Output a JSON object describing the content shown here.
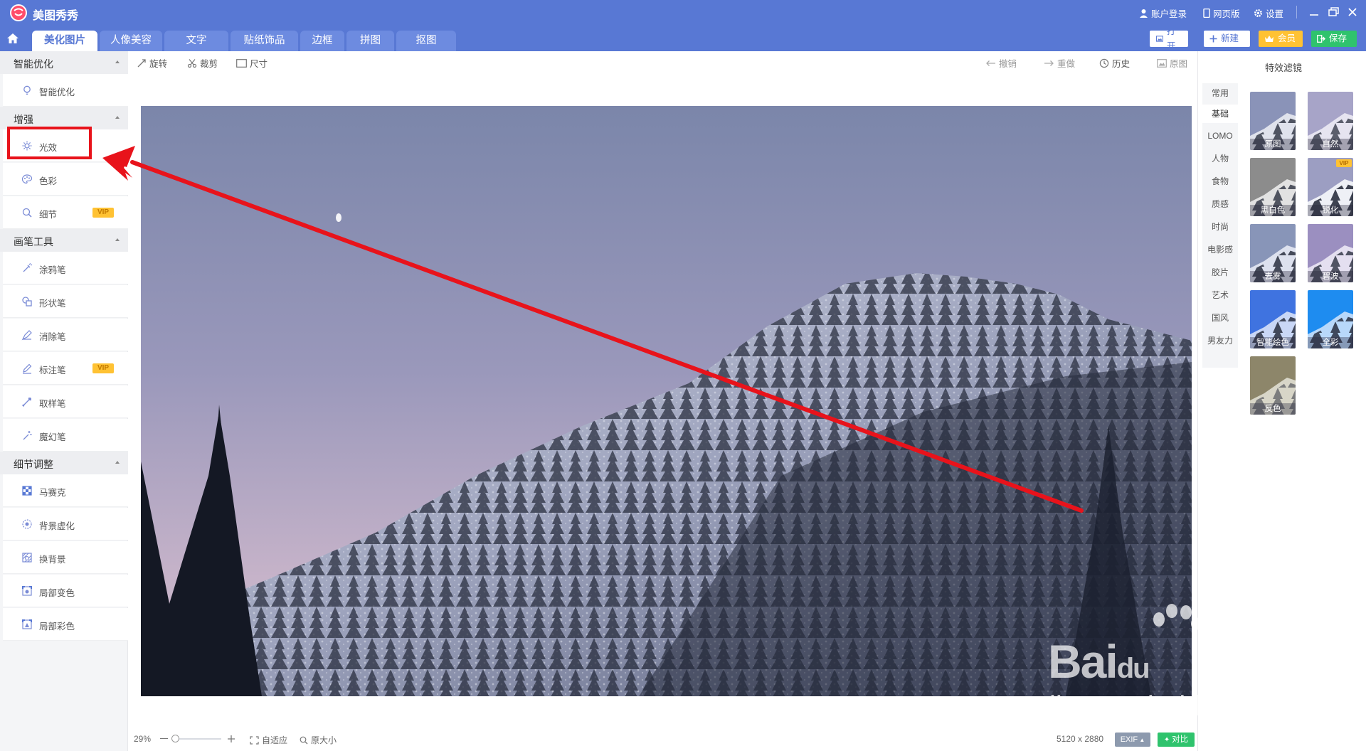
{
  "app": {
    "title": "美图秀秀"
  },
  "titlebar": {
    "login": "账户登录",
    "web": "网页版",
    "settings": "设置"
  },
  "nav": {
    "tabs": [
      "美化图片",
      "人像美容",
      "文字",
      "贴纸饰品",
      "边框",
      "拼图",
      "抠图"
    ],
    "active_index": 0
  },
  "actions": {
    "open": "打开",
    "new": "新建",
    "vip": "会员",
    "save": "保存"
  },
  "left_panel": {
    "sections": [
      {
        "title": "智能优化",
        "items": [
          {
            "label": "智能优化",
            "icon": "bulb-icon"
          }
        ]
      },
      {
        "title": "增强",
        "items": [
          {
            "label": "光效",
            "icon": "sun-icon"
          },
          {
            "label": "色彩",
            "icon": "palette-icon"
          },
          {
            "label": "细节",
            "icon": "magnifier-icon",
            "badge": "VIP"
          }
        ]
      },
      {
        "title": "画笔工具",
        "items": [
          {
            "label": "涂鸦笔",
            "icon": "graffiti-icon"
          },
          {
            "label": "形状笔",
            "icon": "shape-icon"
          },
          {
            "label": "消除笔",
            "icon": "eraser-icon"
          },
          {
            "label": "标注笔",
            "icon": "marker-icon",
            "badge": "VIP"
          },
          {
            "label": "取样笔",
            "icon": "eyedropper-icon"
          },
          {
            "label": "魔幻笔",
            "icon": "magic-icon"
          }
        ]
      },
      {
        "title": "细节调整",
        "items": [
          {
            "label": "马赛克",
            "icon": "mosaic-icon"
          },
          {
            "label": "背景虚化",
            "icon": "blur-icon"
          },
          {
            "label": "换背景",
            "icon": "background-icon"
          },
          {
            "label": "局部变色",
            "icon": "recolor-icon"
          },
          {
            "label": "局部彩色",
            "icon": "colorize-icon"
          }
        ]
      }
    ]
  },
  "canvas_toolbar": {
    "rotate": "旋转",
    "crop": "裁剪",
    "size": "尺寸",
    "undo": "撤销",
    "redo": "重做",
    "history": "历史",
    "original": "原图"
  },
  "bottom_bar": {
    "zoom": "29%",
    "fit": "自适应",
    "actual_size": "原大小",
    "dimensions": "5120 x 2880",
    "exif": "EXIF",
    "compare": "对比"
  },
  "filters": {
    "title": "特效滤镜",
    "categories": [
      "常用",
      "基础",
      "LOMO",
      "人物",
      "食物",
      "质感",
      "时尚",
      "电影感",
      "胶片",
      "艺术",
      "国风",
      "男友力"
    ],
    "active_category": 1,
    "items": [
      {
        "label": "原图",
        "tint": "#8a93b8"
      },
      {
        "label": "自然",
        "tint": "#a7a4c8"
      },
      {
        "label": "黑白色",
        "tint": "#8c8c8c"
      },
      {
        "label": "锐化",
        "tint": "#9c9ec2",
        "badge": "VIP"
      },
      {
        "label": "去雾",
        "tint": "#8895b8"
      },
      {
        "label": "碧波",
        "tint": "#9b8fc0"
      },
      {
        "label": "智能绘色",
        "tint": "#3f73e0"
      },
      {
        "label": "全彩",
        "tint": "#1e8cf0"
      },
      {
        "label": "反色",
        "tint": "#8d866a"
      }
    ]
  },
  "watermark": {
    "brand": "Bai",
    "brand_du": "du",
    "cn": "经验",
    "url": "jingyan.baidu.com"
  },
  "colors": {
    "header": "#5878d4",
    "annotation": "#e8131b",
    "vip": "#ffc233",
    "save": "#2fc36d"
  }
}
